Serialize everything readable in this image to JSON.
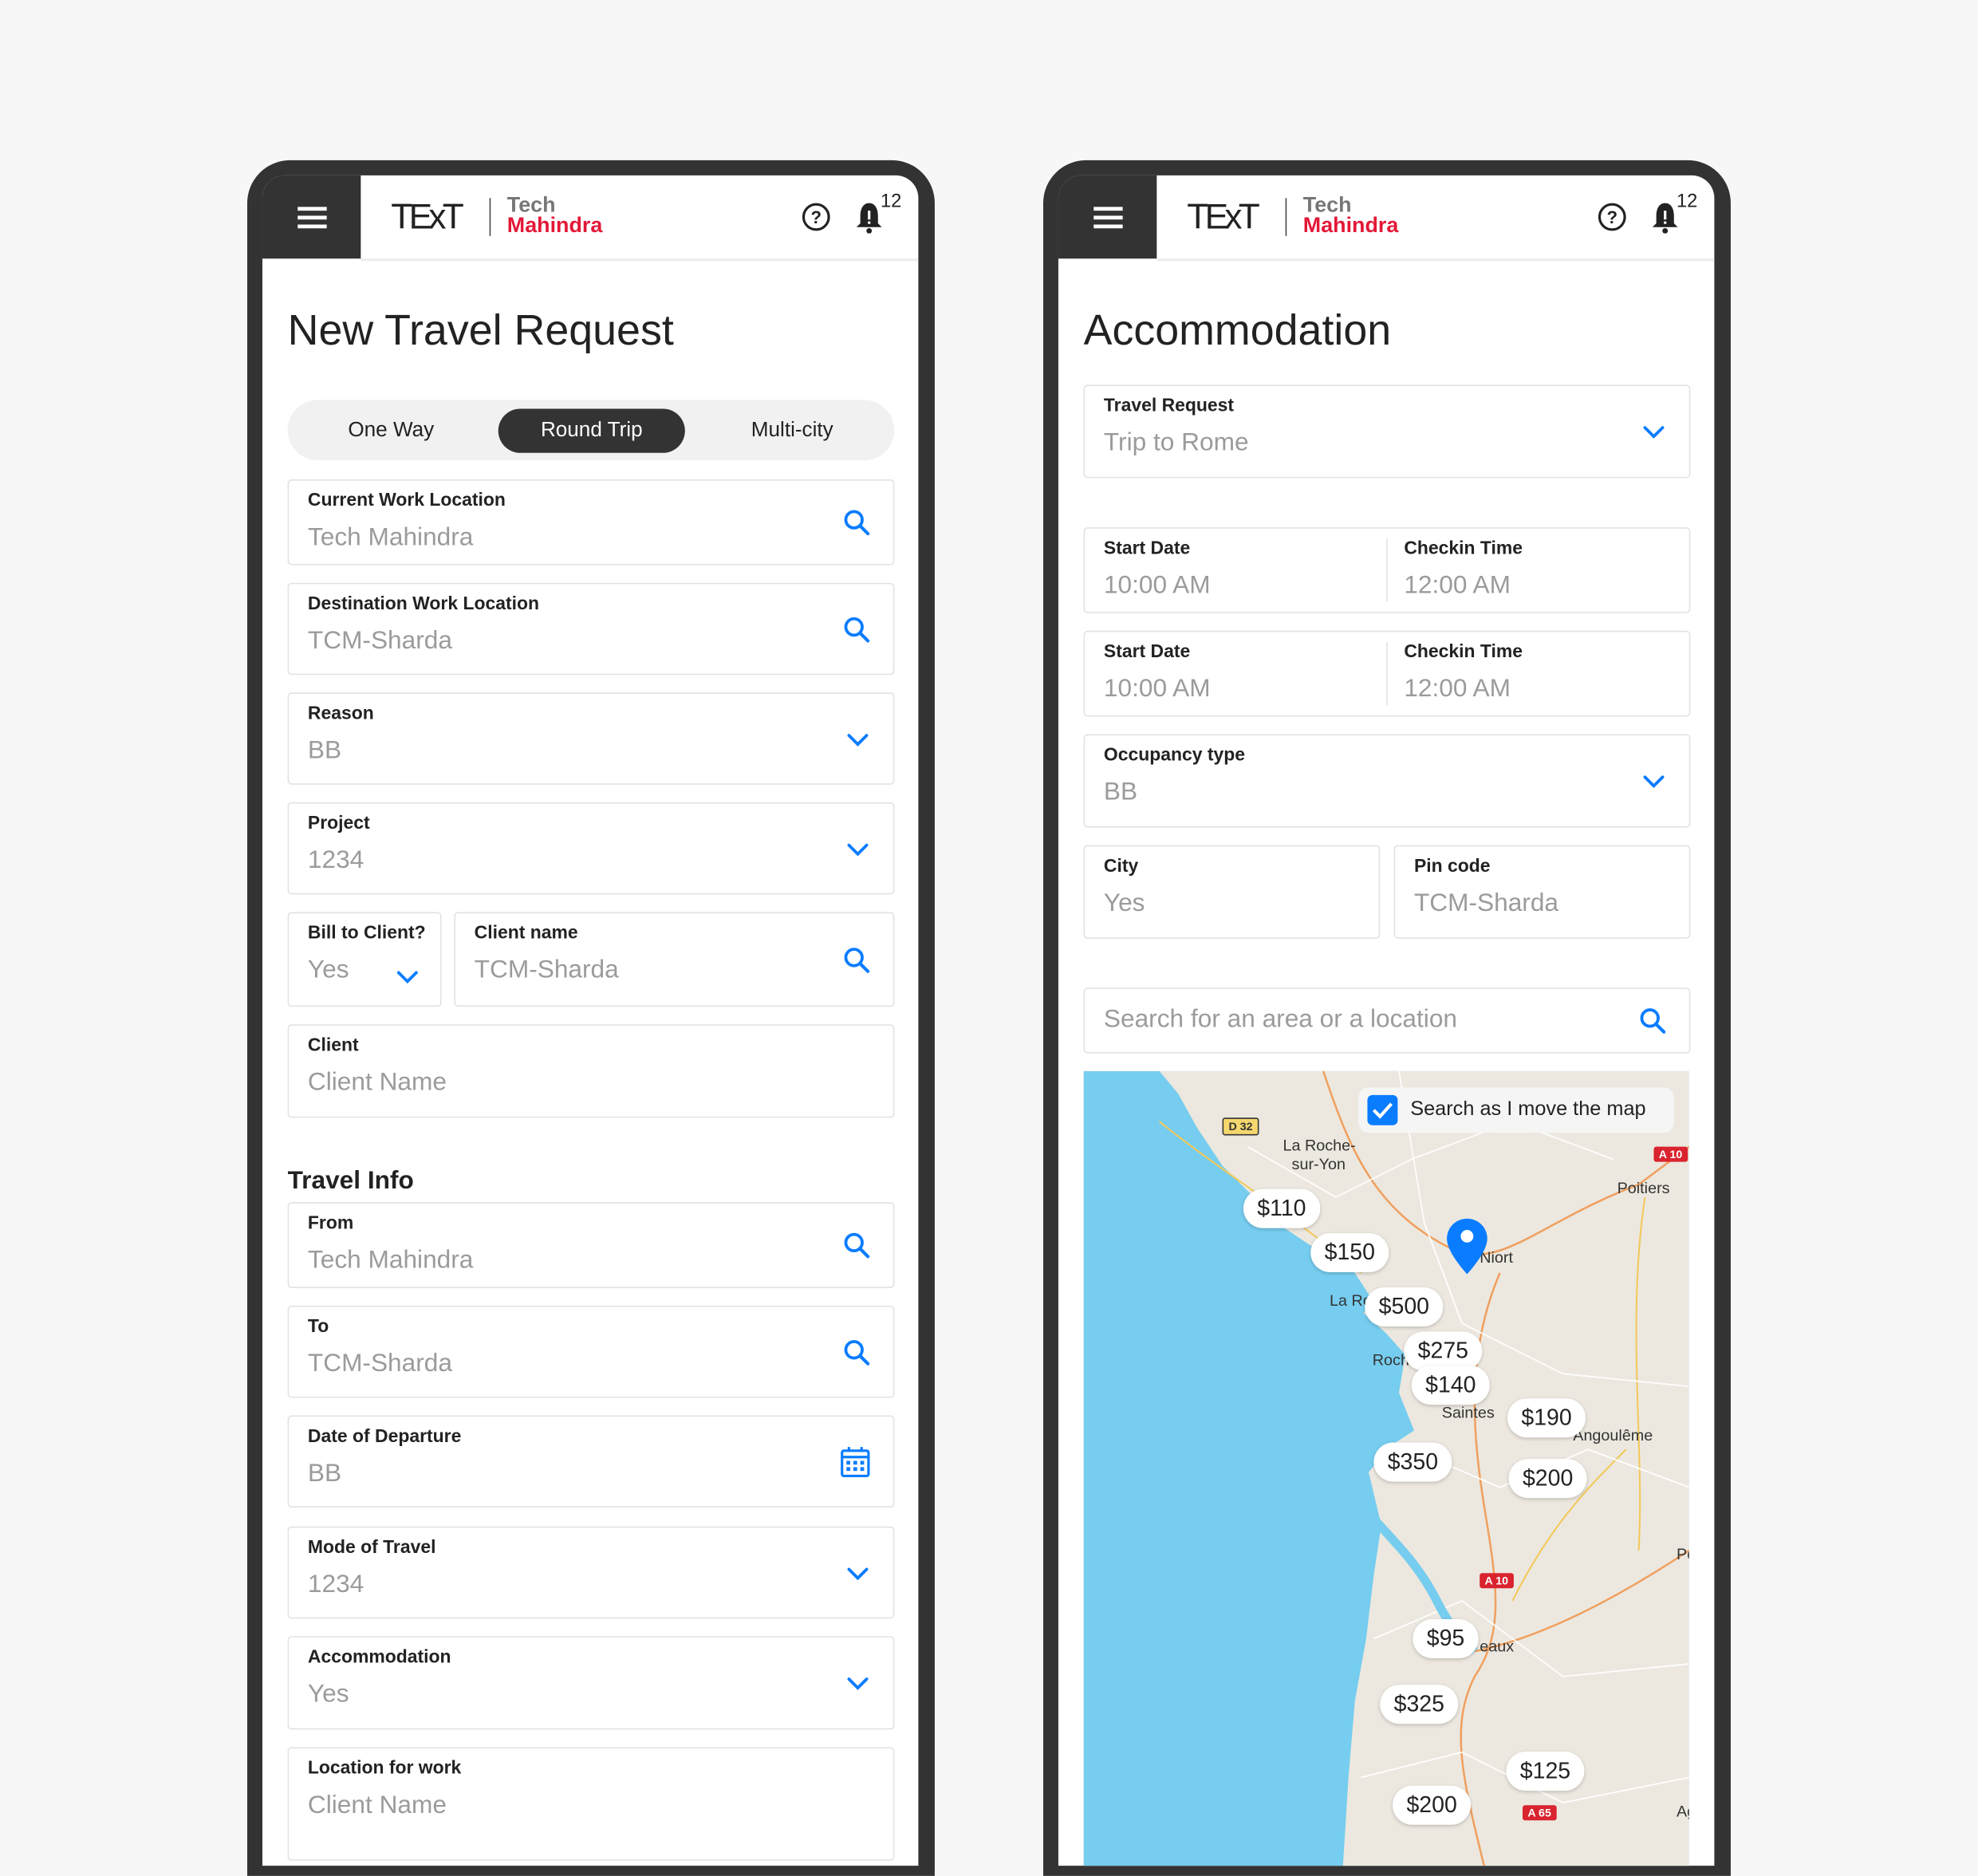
{
  "brand": {
    "logo_text": "TExT",
    "logo_tech": "Tech",
    "logo_mahindra": "Mahindra",
    "notification_count": "12"
  },
  "colors": {
    "accent": "#0a7cff",
    "dark": "#333333",
    "brand_red": "#e31837",
    "sea": "#76cdef",
    "land": "#ece8df"
  },
  "left": {
    "title": "New Travel Request",
    "trip_types": [
      {
        "label": "One Way"
      },
      {
        "label": "Round Trip",
        "selected": true
      },
      {
        "label": "Multi-city"
      }
    ],
    "fields": {
      "current_work_location": {
        "label": "Current Work Location",
        "value": "Tech Mahindra",
        "icon": "search-icon"
      },
      "destination_work_location": {
        "label": "Destination Work Location",
        "value": "TCM-Sharda",
        "icon": "search-icon"
      },
      "reason": {
        "label": "Reason",
        "value": "BB",
        "icon": "chevron-down-icon"
      },
      "project": {
        "label": "Project",
        "value": "1234",
        "icon": "chevron-down-icon"
      },
      "bill_to_client": {
        "label": "Bill to Client?",
        "value": "Yes",
        "icon": "chevron-down-icon"
      },
      "client_name": {
        "label": "Client name",
        "value": "TCM-Sharda",
        "icon": "search-icon"
      },
      "client": {
        "label": "Client",
        "value": "Client Name"
      }
    },
    "travel_info": {
      "heading": "Travel Info",
      "from": {
        "label": "From",
        "value": "Tech Mahindra",
        "icon": "search-icon"
      },
      "to": {
        "label": "To",
        "value": "TCM-Sharda",
        "icon": "search-icon"
      },
      "date_of_departure": {
        "label": "Date of Departure",
        "value": "BB",
        "icon": "calendar-icon"
      },
      "mode_of_travel": {
        "label": "Mode of Travel",
        "value": "1234",
        "icon": "chevron-down-icon"
      },
      "accommodation": {
        "label": "Accommodation",
        "value": "Yes",
        "icon": "chevron-down-icon"
      },
      "location_for_work": {
        "label": "Location for work",
        "value": "Client Name"
      }
    }
  },
  "right": {
    "title": "Accommodation",
    "travel_request": {
      "label": "Travel Request",
      "value": "Trip to Rome",
      "icon": "chevron-down-icon"
    },
    "row1": {
      "start_label": "Start Date",
      "start_value": "10:00 AM",
      "checkin_label": "Checkin Time",
      "checkin_value": "12:00 AM"
    },
    "row2": {
      "start_label": "Start Date",
      "start_value": "10:00 AM",
      "checkin_label": "Checkin Time",
      "checkin_value": "12:00 AM"
    },
    "occupancy": {
      "label": "Occupancy type",
      "value": "BB",
      "icon": "chevron-down-icon"
    },
    "city": {
      "label": "City",
      "value": "Yes"
    },
    "pin_code": {
      "label": "Pin code",
      "value": "TCM-Sharda"
    },
    "search": {
      "placeholder": "Search for an area or a location"
    },
    "map": {
      "search_as_move": {
        "label": "Search as I move the map",
        "checked": true
      },
      "prices": [
        "$110",
        "$150",
        "$500",
        "$275",
        "$140",
        "$190",
        "$350",
        "$200",
        "$95",
        "$325",
        "$125",
        "$200"
      ],
      "places": [
        "La Roche-",
        "sur-Yon",
        "Niort",
        "Poitiers",
        "La Ro",
        "Roch",
        "Saintes",
        "Angoulême",
        "eaux",
        "Po",
        "Ag"
      ],
      "roads": [
        "D 32",
        "A 10",
        "A 10",
        "A 65"
      ]
    }
  }
}
